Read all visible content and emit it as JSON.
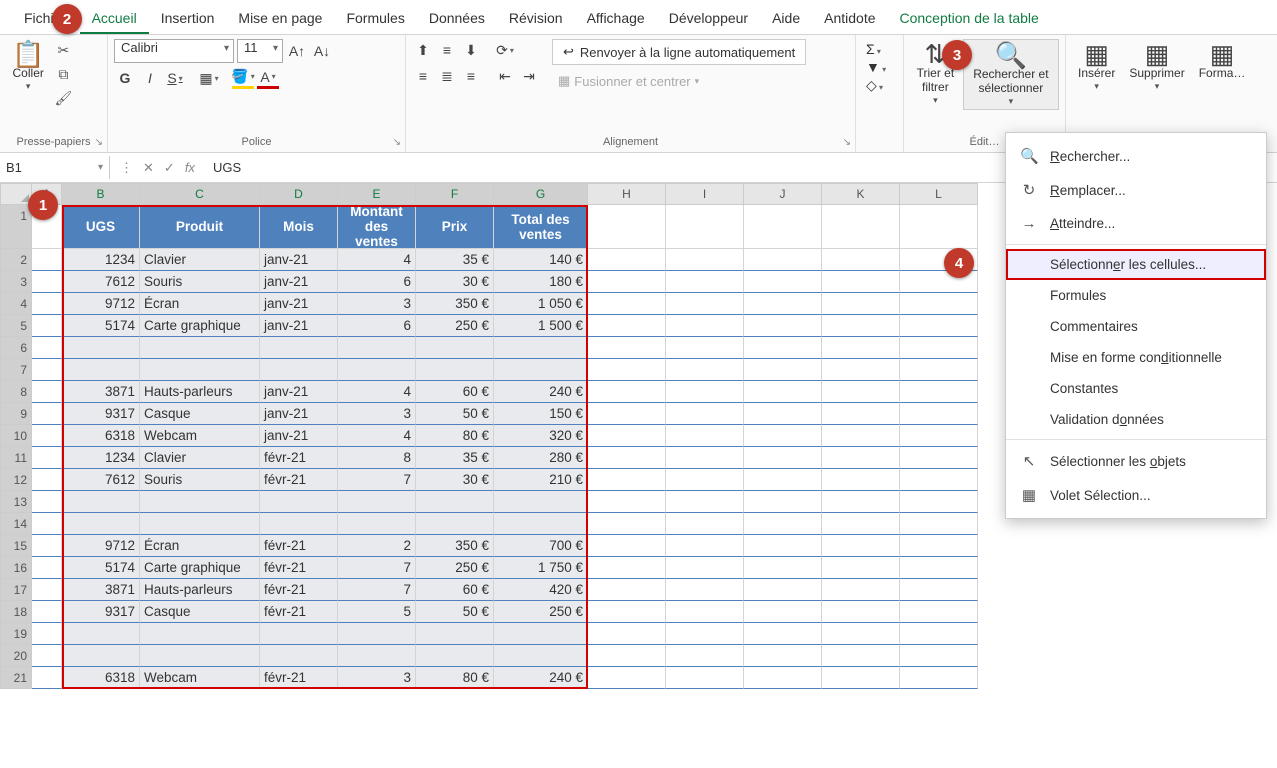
{
  "tabs": [
    "Fichi…",
    "Accueil",
    "Insertion",
    "Mise en page",
    "Formules",
    "Données",
    "Révision",
    "Affichage",
    "Développeur",
    "Aide",
    "Antidote",
    "Conception de la table"
  ],
  "active_tab": "Accueil",
  "groups": {
    "clipboard": {
      "paste": "Coller",
      "label": "Presse-papiers"
    },
    "font": {
      "name": "Calibri",
      "size": "11",
      "label": "Police",
      "bold": "G",
      "italic": "I",
      "underline": "S"
    },
    "align": {
      "label": "Alignement",
      "wrap": "Renvoyer à la ligne automatiquement",
      "merge": "Fusionner et centrer"
    },
    "editing": {
      "label": "Édit…",
      "sort": "Trier et filtrer",
      "find": "Rechercher et sélectionner"
    },
    "cells": {
      "insert": "Insérer",
      "delete": "Supprimer",
      "format": "Forma…"
    }
  },
  "name_box": "B1",
  "formula_value": "UGS",
  "columns": [
    "A",
    "B",
    "C",
    "D",
    "E",
    "F",
    "G",
    "H",
    "I",
    "J",
    "K",
    "L"
  ],
  "headers": [
    "UGS",
    "Produit",
    "Mois",
    "Montant des ventes",
    "Prix",
    "Total des ventes"
  ],
  "rows": [
    {
      "n": 1
    },
    {
      "n": 2,
      "d": [
        "1234",
        "Clavier",
        "janv-21",
        "4",
        "35 €",
        "140 €"
      ]
    },
    {
      "n": 3,
      "d": [
        "7612",
        "Souris",
        "janv-21",
        "6",
        "30 €",
        "180 €"
      ]
    },
    {
      "n": 4,
      "d": [
        "9712",
        "Écran",
        "janv-21",
        "3",
        "350 €",
        "1 050 €"
      ]
    },
    {
      "n": 5,
      "d": [
        "5174",
        "Carte graphique",
        "janv-21",
        "6",
        "250 €",
        "1 500 €"
      ]
    },
    {
      "n": 6,
      "d": [
        "",
        "",
        "",
        "",
        "",
        ""
      ]
    },
    {
      "n": 7,
      "d": [
        "",
        "",
        "",
        "",
        "",
        ""
      ]
    },
    {
      "n": 8,
      "d": [
        "3871",
        "Hauts-parleurs",
        "janv-21",
        "4",
        "60 €",
        "240 €"
      ]
    },
    {
      "n": 9,
      "d": [
        "9317",
        "Casque",
        "janv-21",
        "3",
        "50 €",
        "150 €"
      ]
    },
    {
      "n": 10,
      "d": [
        "6318",
        "Webcam",
        "janv-21",
        "4",
        "80 €",
        "320 €"
      ]
    },
    {
      "n": 11,
      "d": [
        "1234",
        "Clavier",
        "févr-21",
        "8",
        "35 €",
        "280 €"
      ]
    },
    {
      "n": 12,
      "d": [
        "7612",
        "Souris",
        "févr-21",
        "7",
        "30 €",
        "210 €"
      ]
    },
    {
      "n": 13,
      "d": [
        "",
        "",
        "",
        "",
        "",
        ""
      ]
    },
    {
      "n": 14,
      "d": [
        "",
        "",
        "",
        "",
        "",
        ""
      ]
    },
    {
      "n": 15,
      "d": [
        "9712",
        "Écran",
        "févr-21",
        "2",
        "350 €",
        "700 €"
      ]
    },
    {
      "n": 16,
      "d": [
        "5174",
        "Carte graphique",
        "févr-21",
        "7",
        "250 €",
        "1 750 €"
      ]
    },
    {
      "n": 17,
      "d": [
        "3871",
        "Hauts-parleurs",
        "févr-21",
        "7",
        "60 €",
        "420 €"
      ]
    },
    {
      "n": 18,
      "d": [
        "9317",
        "Casque",
        "févr-21",
        "5",
        "50 €",
        "250 €"
      ]
    },
    {
      "n": 19,
      "d": [
        "",
        "",
        "",
        "",
        "",
        ""
      ]
    },
    {
      "n": 20,
      "d": [
        "",
        "",
        "",
        "",
        "",
        ""
      ]
    },
    {
      "n": 21,
      "d": [
        "6318",
        "Webcam",
        "févr-21",
        "3",
        "80 €",
        "240 €"
      ]
    }
  ],
  "menu": [
    {
      "icon": "🔍",
      "label": "Rechercher...",
      "u": 0
    },
    {
      "icon": "↻",
      "label": "Remplacer...",
      "u": 0
    },
    {
      "icon": "→",
      "label": "Atteindre...",
      "u": 0
    },
    {
      "sep": true
    },
    {
      "icon": "",
      "label": "Sélectionner les cellules...",
      "hl": true,
      "u": 10
    },
    {
      "icon": "",
      "label": "Formules",
      "u": -1
    },
    {
      "icon": "",
      "label": "Commentaires",
      "u": -1
    },
    {
      "icon": "",
      "label": "Mise en forme conditionnelle",
      "u": 17
    },
    {
      "icon": "",
      "label": "Constantes",
      "u": -1
    },
    {
      "icon": "",
      "label": "Validation données",
      "u": 12
    },
    {
      "sep": true
    },
    {
      "icon": "↖",
      "label": "Sélectionner les objets",
      "u": 17
    },
    {
      "icon": "▦",
      "label": "Volet Sélection...",
      "u": -1
    }
  ],
  "callouts": {
    "1": "1",
    "2": "2",
    "3": "3",
    "4": "4"
  }
}
